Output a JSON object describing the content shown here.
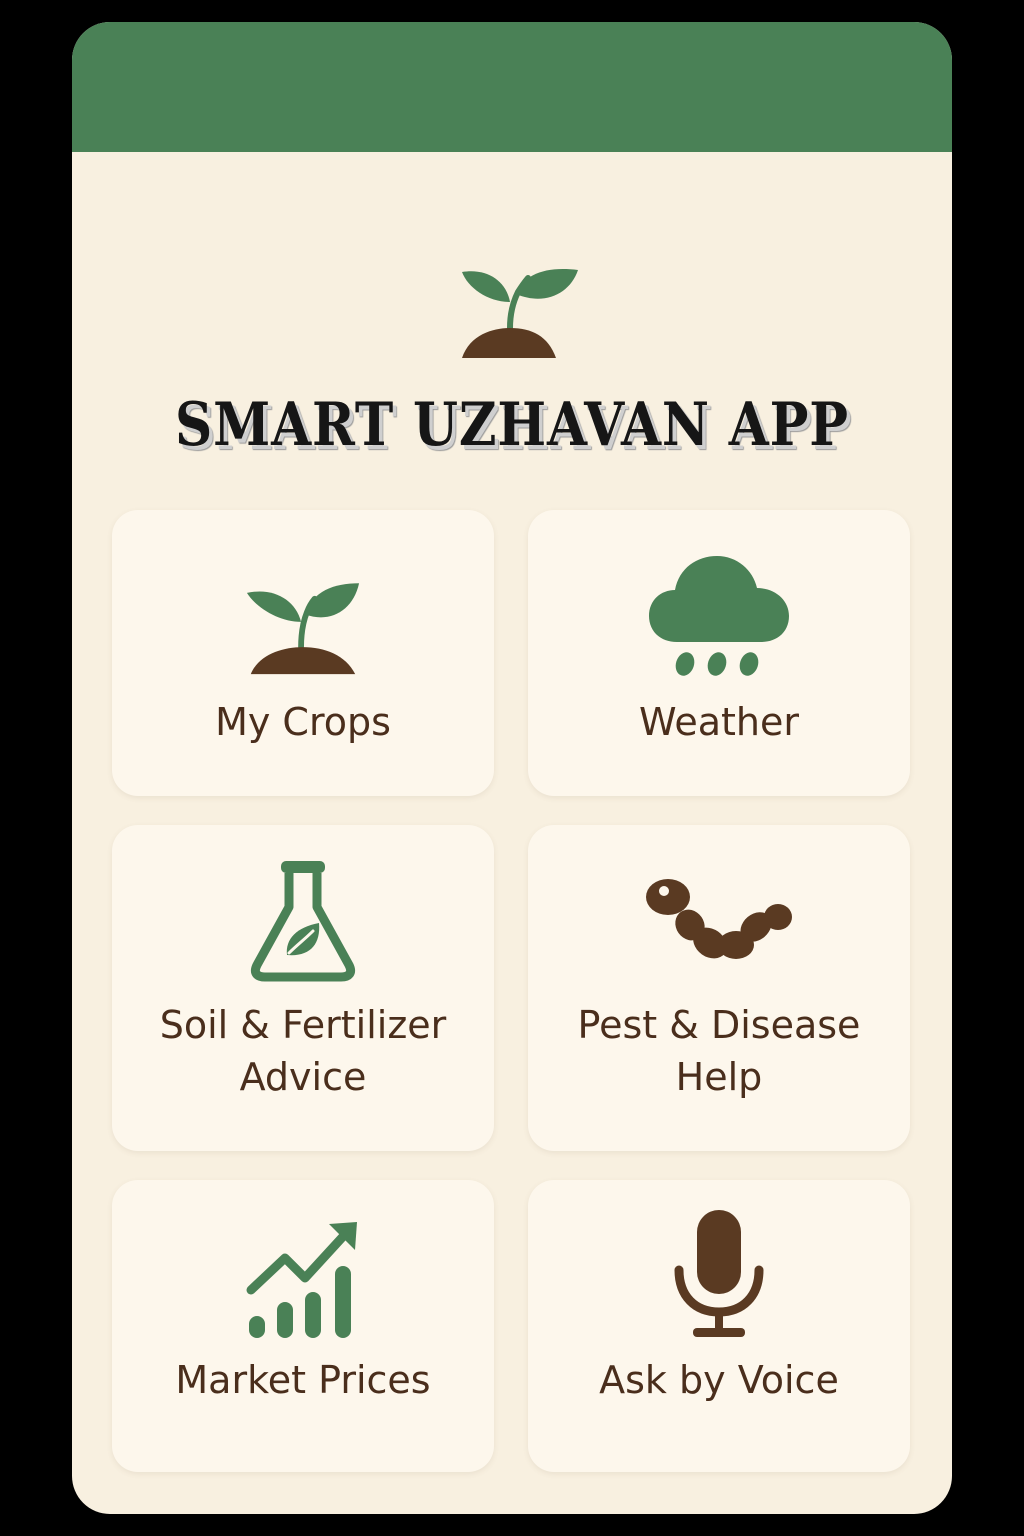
{
  "app": {
    "title": "SMART UZHAVAN APP"
  },
  "colors": {
    "header_green": "#4a8156",
    "background_cream": "#f8f0e0",
    "card_cream": "#fdf7ec",
    "icon_green": "#4a8156",
    "icon_brown": "#5a3a22",
    "label_brown": "#4a2e1c"
  },
  "menu": [
    {
      "id": "my-crops",
      "label": "My Crops",
      "icon": "sprout-icon"
    },
    {
      "id": "weather",
      "label": "Weather",
      "icon": "rain-cloud-icon"
    },
    {
      "id": "soil-fertilizer",
      "label_lines": [
        "Soil & Fertilizer",
        "Advice"
      ],
      "icon": "flask-leaf-icon"
    },
    {
      "id": "pest-disease",
      "label_lines": [
        "Pest & Disease",
        "Help"
      ],
      "icon": "worm-icon"
    },
    {
      "id": "market-prices",
      "label": "Market Prices",
      "icon": "growth-chart-icon"
    },
    {
      "id": "ask-by-voice",
      "label": "Ask by Voice",
      "icon": "microphone-icon"
    }
  ]
}
